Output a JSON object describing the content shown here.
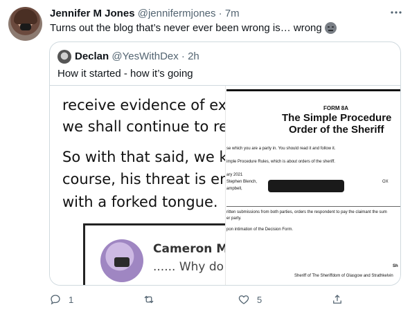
{
  "tweet": {
    "author_name": "Jennifer M Jones",
    "author_handle": "@jennifermjones",
    "separator": "·",
    "time": "7m",
    "text": "Turns out the blog that’s never ever been wrong is… wrong",
    "emoji_icon": "neutral-face-emoji"
  },
  "quote": {
    "author_name": "Declan",
    "author_handle": "@YesWithDex",
    "separator": "·",
    "time": "2h",
    "text": "How it started - how it’s going",
    "media": {
      "left": {
        "lines": [
          "receive evidence of exist",
          "we shall continue to rega",
          "So with that said, we kee",
          "course, his threat is emp",
          "with a forked tongue."
        ],
        "card_name": "Cameron Mc",
        "card_sub": "...... Why do p"
      },
      "right": {
        "form_label": "FORM 8A",
        "title_line1": "The Simple Procedure",
        "title_line2": "Order of the Sheriff",
        "line1": "se which you are a party in. You should read it and follow it.",
        "line2": "imple Procedure Rules, which is about orders of the sheriff.",
        "line3": "ary 2021",
        "line4": "Stephen Blench,",
        "line5": "ampbell,",
        "line6": "ritten submissions from both parties, orders the respondent to pay the claimant the sum",
        "line7": "er party.",
        "line8": "pon intimation of the Decision Form.",
        "footer": "Sheriff of The Sheriffdom of Glasgow and Strathkelvin",
        "sh": "Sh",
        "ox": "OX"
      }
    }
  },
  "actions": {
    "reply_count": "1",
    "retweet_count": "",
    "like_count": "5",
    "share_count": ""
  }
}
